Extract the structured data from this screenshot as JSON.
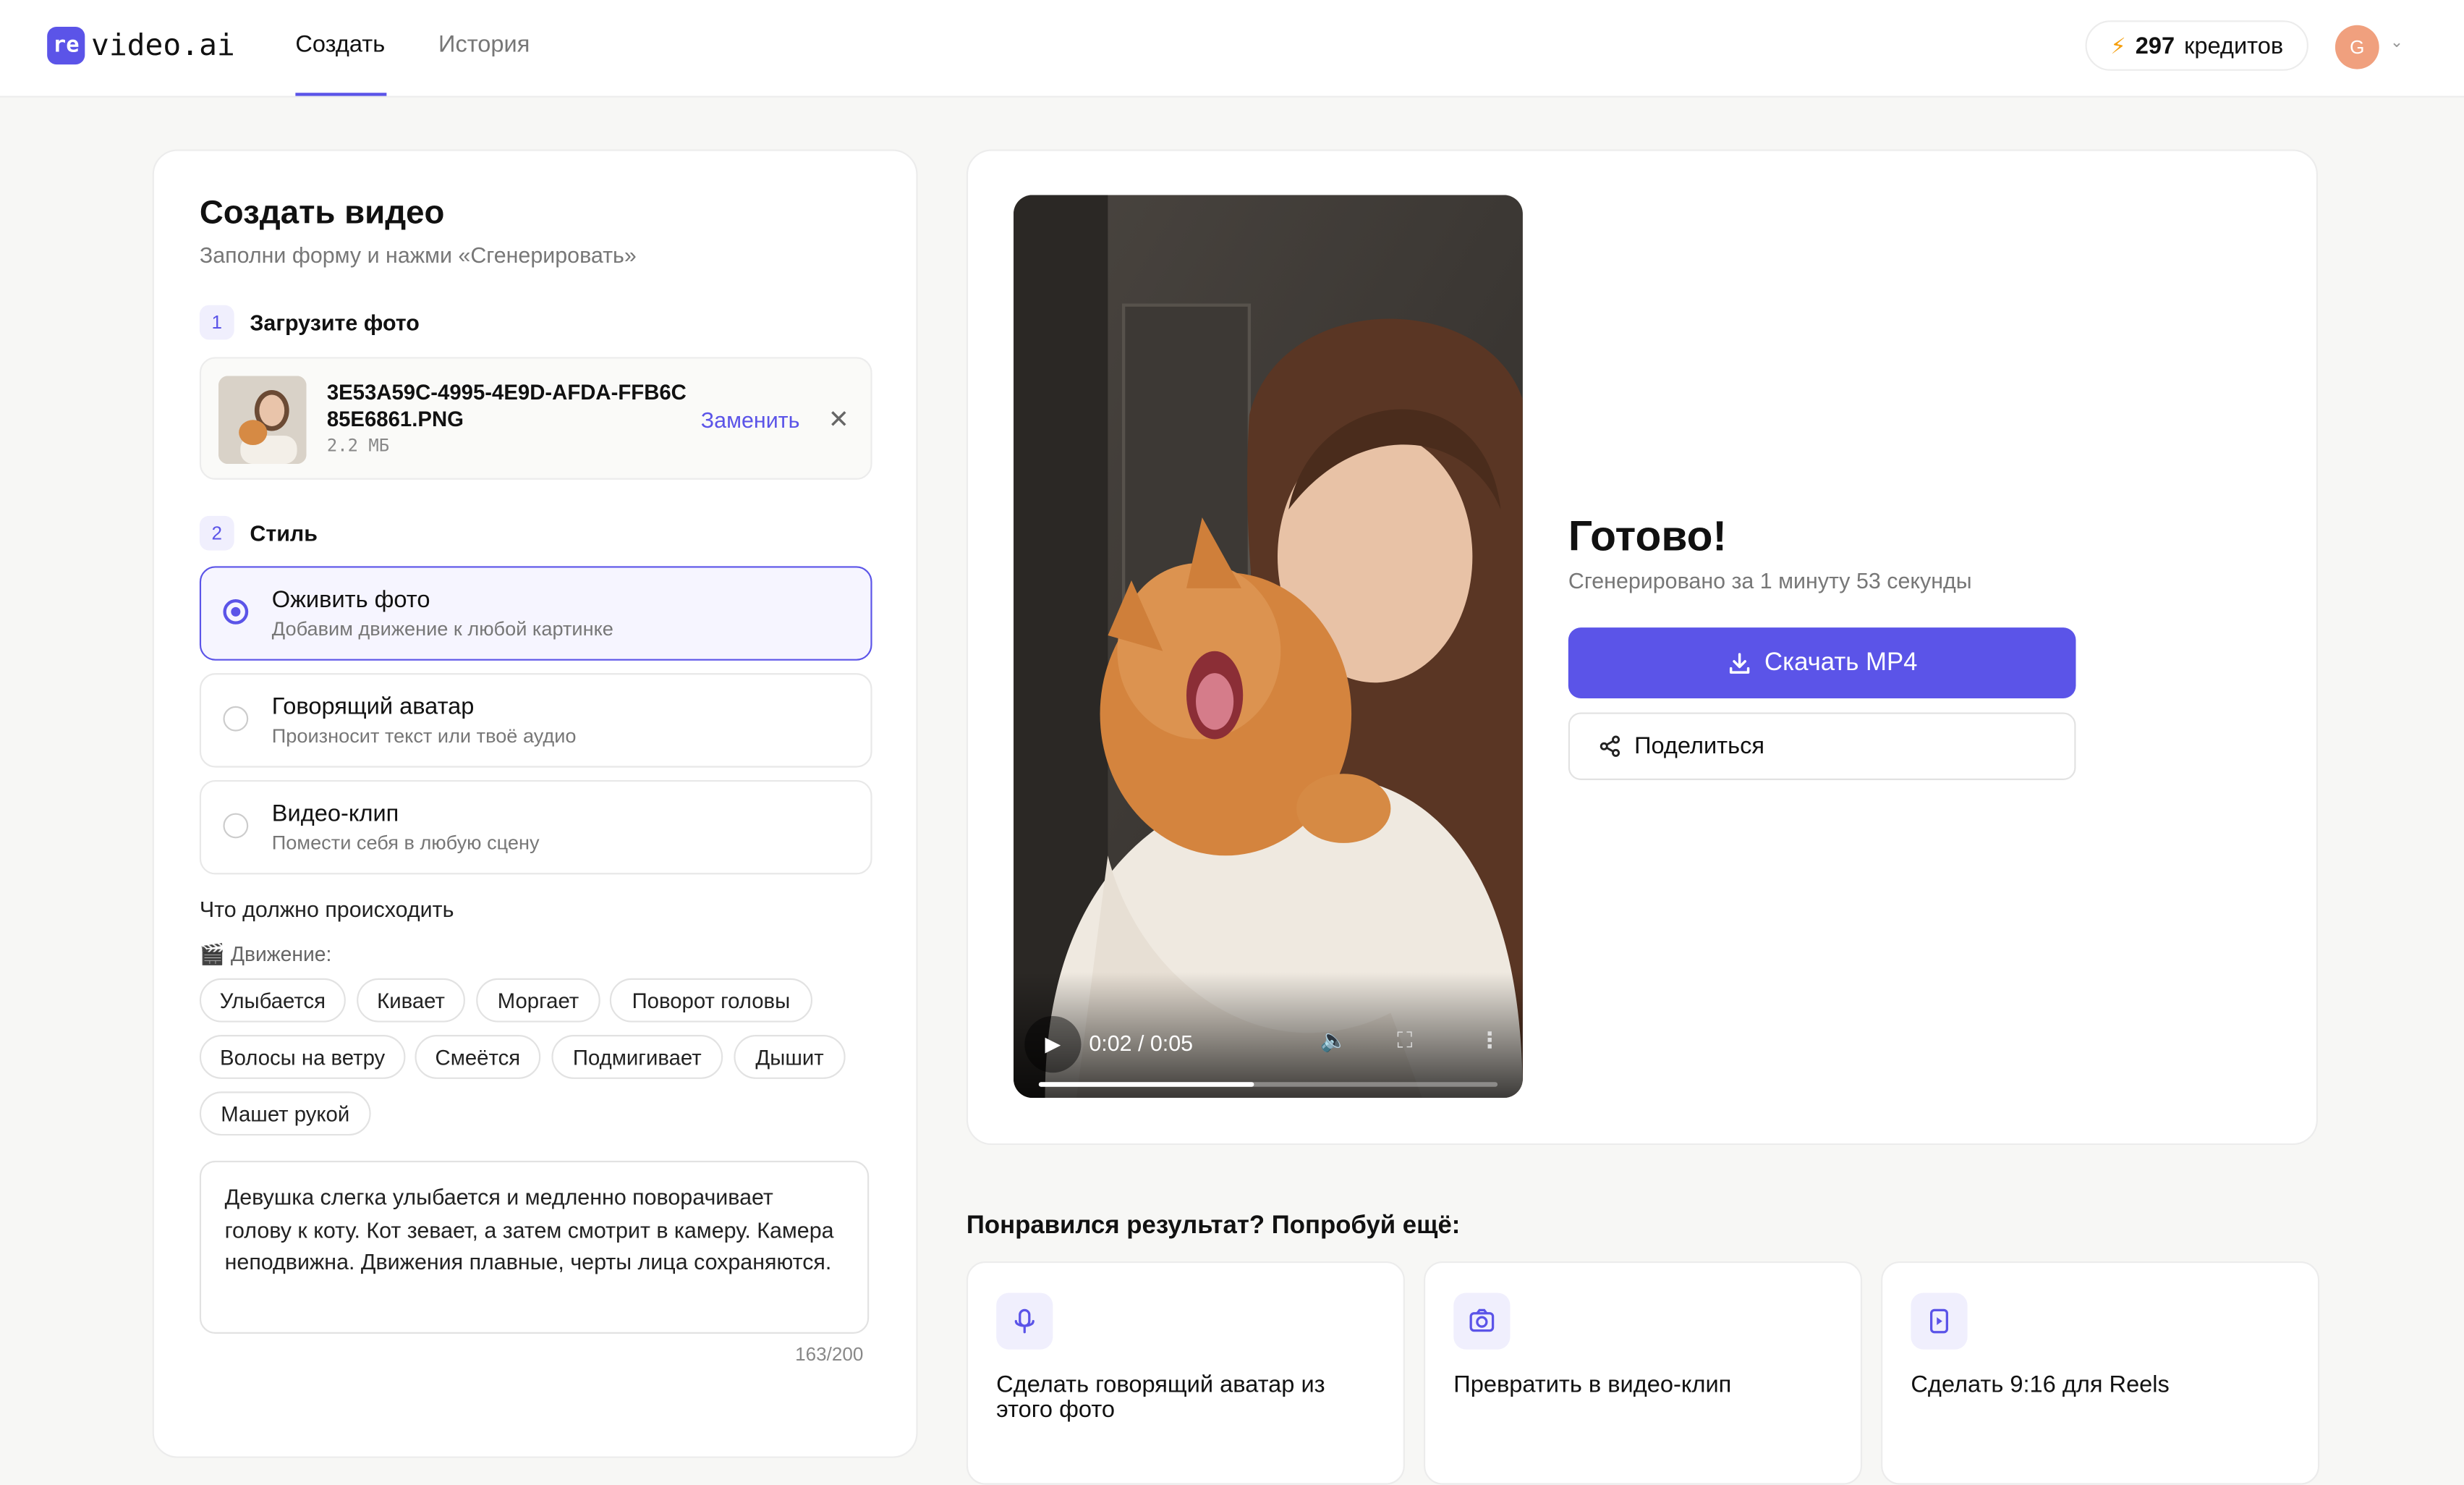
{
  "header": {
    "logo_mark": "re",
    "logo_text": "video.ai",
    "tabs": [
      {
        "label": "Создать"
      },
      {
        "label": "История"
      }
    ],
    "credits_count": "297",
    "credits_label": "кредитов",
    "avatar_initial": "G"
  },
  "form": {
    "title": "Создать видео",
    "subtitle": "Заполни форму и нажми «Сгенерировать»",
    "step1": {
      "num": "1",
      "label": "Загрузите фото"
    },
    "file": {
      "name": "3E53A59C-4995-4E9D-AFDA-FFB6C85E6861.PNG",
      "size": "2.2 МБ",
      "replace_label": "Заменить",
      "remove_icon": "close-icon"
    },
    "step2": {
      "num": "2",
      "label": "Стиль"
    },
    "styles": [
      {
        "title": "Оживить фото",
        "desc": "Добавим движение к любой картинке",
        "selected": true
      },
      {
        "title": "Говорящий аватар",
        "desc": "Произносит текст или твоё аудио",
        "selected": false
      },
      {
        "title": "Видео-клип",
        "desc": "Помести себя в любую сцену",
        "selected": false
      }
    ],
    "what_label": "Что должно происходить",
    "motion_label": "🎬 Движение:",
    "chips": [
      "Улыбается",
      "Кивает",
      "Моргает",
      "Поворот головы",
      "Волосы на ветру",
      "Смеётся",
      "Подмигивает",
      "Дышит",
      "Машет рукой"
    ],
    "prompt": "Девушка слегка улыбается и медленно поворачивает голову к коту. Кот зевает, а затем смотрит в камеру. Камера неподвижна. Движения плавные, черты лица сохраняются.",
    "counter": "163/200"
  },
  "result": {
    "video_time": "0:02 / 0:05",
    "video_progress": 0.47,
    "title": "Готово!",
    "subtitle": "Сгенерировано за 1 минуту 53 секунды",
    "download_label": "Скачать MP4",
    "share_label": "Поделиться"
  },
  "suggestions": {
    "title": "Понравился результат? Попробуй ещё:",
    "items": [
      {
        "text": "Сделать говорящий аватар из этого фото",
        "icon": "microphone-icon"
      },
      {
        "text": "Превратить в видео-клип",
        "icon": "camera-icon"
      },
      {
        "text": "Сделать 9:16 для Reels",
        "icon": "video-file-icon"
      }
    ]
  },
  "colors": {
    "accent": "#5b54e8",
    "accent_light": "#f0effd",
    "credit_bolt": "#f59e0b",
    "avatar": "#f0a07e"
  }
}
